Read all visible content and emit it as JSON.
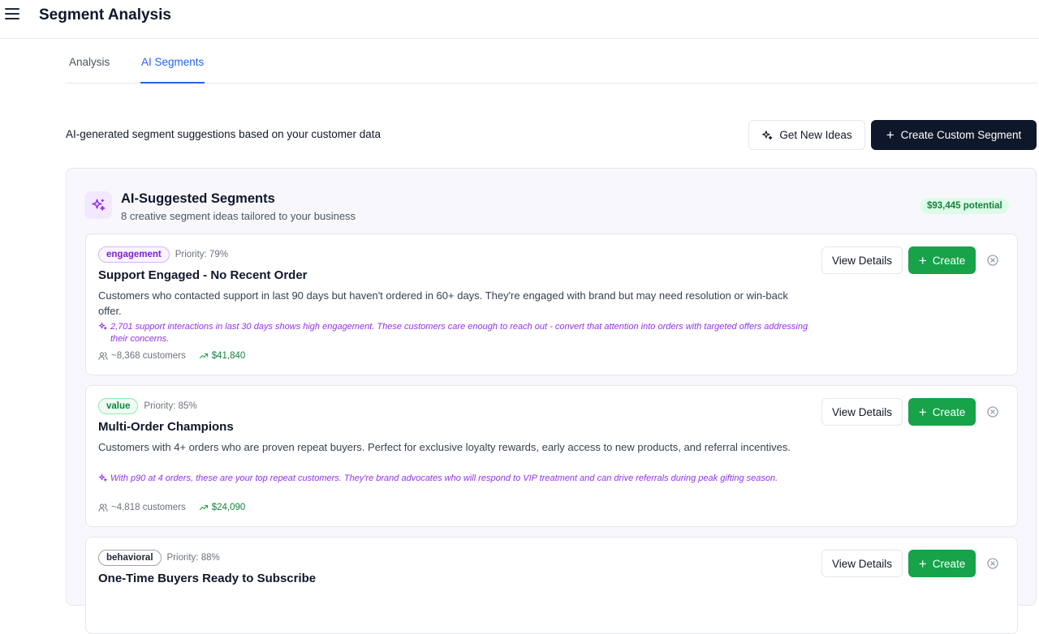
{
  "header": {
    "title": "Segment Analysis",
    "menu_icon": "hamburger-menu-icon"
  },
  "tabs": [
    {
      "label": "Analysis",
      "active": false
    },
    {
      "label": "AI Segments",
      "active": true
    }
  ],
  "intro": {
    "text": "AI-generated segment suggestions based on your customer data",
    "get_ideas_label": "Get New Ideas",
    "create_custom_label": "Create Custom Segment"
  },
  "panel": {
    "title": "AI-Suggested Segments",
    "subtitle": "8 creative segment ideas tailored to your business",
    "potential": "$93,445 potential"
  },
  "cards": [
    {
      "tag": "engagement",
      "priority": "Priority: 79%",
      "title": "Support Engaged - No Recent Order",
      "description": "Customers who contacted support in last 90 days but haven't ordered in 60+ days. They're engaged with brand but may need resolution or win-back offer.",
      "insight": "2,701 support interactions in last 30 days shows high engagement. These customers care enough to reach out - convert that attention into orders with targeted offers addressing their concerns.",
      "customers": "~8,368 customers",
      "revenue": "$41,840",
      "view_label": "View Details",
      "create_label": "Create"
    },
    {
      "tag": "value",
      "priority": "Priority: 85%",
      "title": "Multi-Order Champions",
      "description": "Customers with 4+ orders who are proven repeat buyers. Perfect for exclusive loyalty rewards, early access to new products, and referral incentives.",
      "insight": "With p90 at 4 orders, these are your top repeat customers. They're brand advocates who will respond to VIP treatment and can drive referrals during peak gifting season.",
      "customers": "~4,818 customers",
      "revenue": "$24,090",
      "view_label": "View Details",
      "create_label": "Create"
    },
    {
      "tag": "behavioral",
      "priority": "Priority: 88%",
      "title": "One-Time Buyers Ready to Subscribe",
      "view_label": "View Details",
      "create_label": "Create"
    }
  ],
  "colors": {
    "accent": "#2563eb",
    "primary_dark": "#0f172a",
    "success": "#16a34a",
    "ai_purple": "#9333ea"
  }
}
